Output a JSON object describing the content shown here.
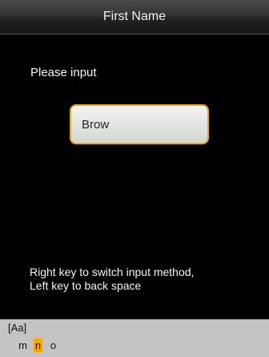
{
  "header": {
    "title": "First Name"
  },
  "prompt": {
    "label": "Please input"
  },
  "input": {
    "value": "Brow"
  },
  "hint": {
    "line1": "Right key to switch input method,",
    "line2": "Left key to back space"
  },
  "ime": {
    "mode": "[Aa]",
    "candidates": [
      "m",
      "n",
      "o"
    ],
    "selected_index": 1
  },
  "colors": {
    "accent": "#e8a820",
    "selection": "#f5a800",
    "ime_background": "#c4c4c4"
  }
}
